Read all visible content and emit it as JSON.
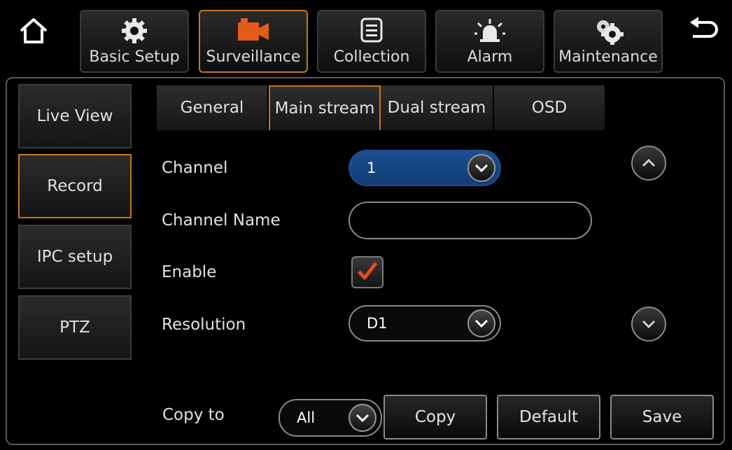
{
  "top_tabs": [
    {
      "label": "Basic Setup",
      "icon": "gear-icon"
    },
    {
      "label": "Surveillance",
      "icon": "camera-icon"
    },
    {
      "label": "Collection",
      "icon": "document-icon"
    },
    {
      "label": "Alarm",
      "icon": "alarm-light-icon"
    },
    {
      "label": "Maintenance",
      "icon": "gears-icon"
    }
  ],
  "side_menu": [
    {
      "label": "Live View"
    },
    {
      "label": "Record"
    },
    {
      "label": "IPC setup"
    },
    {
      "label": "PTZ"
    }
  ],
  "sub_tabs": [
    {
      "label": "General"
    },
    {
      "label": "Main stream"
    },
    {
      "label": "Dual stream"
    },
    {
      "label": "OSD"
    }
  ],
  "form": {
    "channel_label": "Channel",
    "channel_value": "1",
    "channel_name_label": "Channel Name",
    "channel_name_value": "",
    "enable_label": "Enable",
    "enable_checked": true,
    "resolution_label": "Resolution",
    "resolution_value": "D1"
  },
  "footer": {
    "copy_to_label": "Copy to",
    "copy_to_value": "All",
    "copy_button": "Copy",
    "default_button": "Default",
    "save_button": "Save"
  },
  "colors": {
    "accent": "#c8761e",
    "selection_blue": "#1d4f92",
    "check_red": "#e8492a"
  }
}
